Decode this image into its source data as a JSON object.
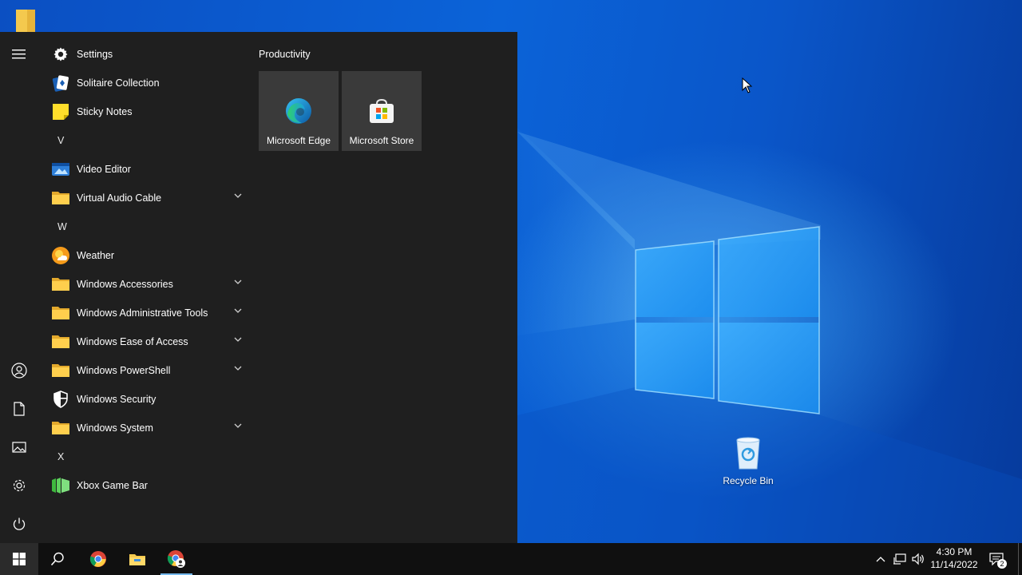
{
  "desktop": {
    "recycle_bin_label": "Recycle Bin"
  },
  "start_menu": {
    "apps": [
      {
        "type": "app",
        "label": "Settings",
        "icon": "gear-icon",
        "expandable": false
      },
      {
        "type": "app",
        "label": "Solitaire Collection",
        "icon": "solitaire-icon",
        "expandable": false
      },
      {
        "type": "app",
        "label": "Sticky Notes",
        "icon": "sticky-notes-icon",
        "expandable": false
      },
      {
        "type": "letter",
        "label": "V"
      },
      {
        "type": "app",
        "label": "Video Editor",
        "icon": "video-editor-icon",
        "expandable": false
      },
      {
        "type": "app",
        "label": "Virtual Audio Cable",
        "icon": "folder-icon",
        "expandable": true
      },
      {
        "type": "letter",
        "label": "W"
      },
      {
        "type": "app",
        "label": "Weather",
        "icon": "weather-icon",
        "expandable": false
      },
      {
        "type": "app",
        "label": "Windows Accessories",
        "icon": "folder-icon",
        "expandable": true
      },
      {
        "type": "app",
        "label": "Windows Administrative Tools",
        "icon": "folder-icon",
        "expandable": true
      },
      {
        "type": "app",
        "label": "Windows Ease of Access",
        "icon": "folder-icon",
        "expandable": true
      },
      {
        "type": "app",
        "label": "Windows PowerShell",
        "icon": "folder-icon",
        "expandable": true
      },
      {
        "type": "app",
        "label": "Windows Security",
        "icon": "shield-icon",
        "expandable": false
      },
      {
        "type": "app",
        "label": "Windows System",
        "icon": "folder-icon",
        "expandable": true
      },
      {
        "type": "letter",
        "label": "X"
      },
      {
        "type": "app",
        "label": "Xbox Game Bar",
        "icon": "xbox-game-bar-icon",
        "expandable": false
      }
    ],
    "tile_group_title": "Productivity",
    "tiles": [
      {
        "label": "Microsoft Edge",
        "icon": "edge-icon"
      },
      {
        "label": "Microsoft Store",
        "icon": "store-icon"
      }
    ],
    "rail_icons": [
      "hamburger-icon",
      "user-icon",
      "documents-icon",
      "pictures-icon",
      "settings-icon",
      "power-icon"
    ]
  },
  "taskbar": {
    "icons": [
      "windows-start-icon",
      "search-icon",
      "chrome-icon",
      "file-explorer-icon",
      "chrome-profile-icon"
    ],
    "tray_icons": [
      "chevron-up-icon",
      "network-icon",
      "volume-icon"
    ],
    "time": "4:30 PM",
    "date": "11/14/2022",
    "notification_count": "2"
  },
  "colors": {
    "start_menu_bg": "#1f1f1f",
    "tile_bg": "#3a3a3a",
    "taskbar_bg": "#101010",
    "accent": "#76b9ed"
  }
}
